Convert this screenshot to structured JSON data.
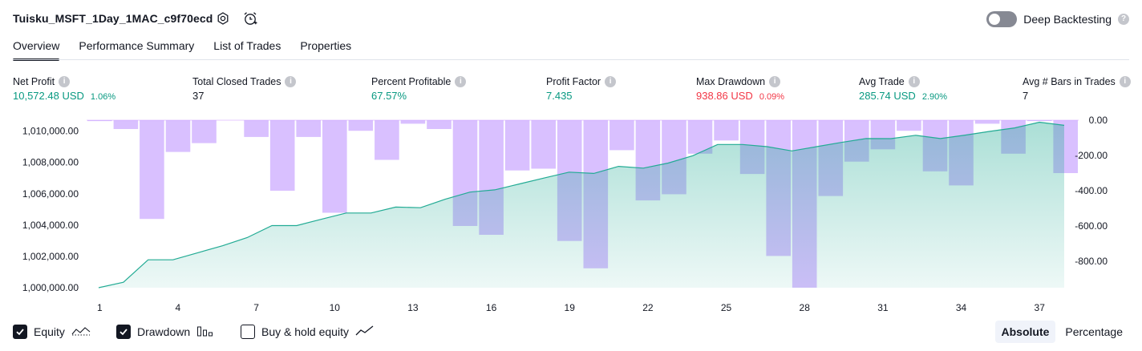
{
  "header": {
    "strategy_title": "Tuisku_MSFT_1Day_1MAC_c9f70ecd",
    "settings_icon": "gear-icon",
    "alert_icon": "alarm-clock-plus-icon",
    "deep_backtesting_label": "Deep Backtesting",
    "deep_backtesting_enabled": false,
    "help_glyph": "?"
  },
  "tabs": [
    {
      "label": "Overview",
      "active": true
    },
    {
      "label": "Performance Summary",
      "active": false
    },
    {
      "label": "List of Trades",
      "active": false
    },
    {
      "label": "Properties",
      "active": false
    }
  ],
  "metrics": [
    {
      "label": "Net Profit",
      "value": "10,572.48 USD",
      "pct": "1.06%",
      "color": "#089981"
    },
    {
      "label": "Total Closed Trades",
      "value": "37",
      "pct": "",
      "color": "#131722"
    },
    {
      "label": "Percent Profitable",
      "value": "67.57%",
      "pct": "",
      "color": "#089981"
    },
    {
      "label": "Profit Factor",
      "value": "7.435",
      "pct": "",
      "color": "#089981"
    },
    {
      "label": "Max Drawdown",
      "value": "938.86 USD",
      "pct": "0.09%",
      "color": "#f23645"
    },
    {
      "label": "Avg Trade",
      "value": "285.74 USD",
      "pct": "2.90%",
      "color": "#089981"
    },
    {
      "label": "Avg # Bars in Trades",
      "value": "7",
      "pct": "",
      "color": "#131722"
    }
  ],
  "chart_data": {
    "type": "area",
    "x_ticks": [
      "1",
      "4",
      "7",
      "10",
      "13",
      "16",
      "19",
      "22",
      "25",
      "28",
      "31",
      "34",
      "37"
    ],
    "left_axis_ticks": [
      "1,010,000.00",
      "1,008,000.00",
      "1,006,000.00",
      "1,004,000.00",
      "1,002,000.00",
      "1,000,000.00"
    ],
    "right_axis_ticks": [
      "0.00",
      "-200.00",
      "-400.00",
      "-600.00",
      "-800.00"
    ],
    "ylim_left": [
      1000000,
      1010700
    ],
    "ylim_right": [
      -950,
      0
    ],
    "series": [
      {
        "name": "Equity",
        "color": "#22ab94",
        "values": [
          1000000,
          1000350,
          1001780,
          1001780,
          1002230,
          1002680,
          1003200,
          1003970,
          1003970,
          1004370,
          1004770,
          1004770,
          1005150,
          1005110,
          1005650,
          1006110,
          1006250,
          1006630,
          1007010,
          1007380,
          1007300,
          1007750,
          1007640,
          1007960,
          1008430,
          1009150,
          1009150,
          1009010,
          1008740,
          1009010,
          1009280,
          1009530,
          1009520,
          1009740,
          1009530,
          1009750,
          1009990,
          1010210,
          1010570,
          1010370
        ]
      },
      {
        "name": "Drawdown",
        "color": "#c199ff",
        "values": [
          -5,
          -50,
          -560,
          -180,
          -130,
          0,
          -95,
          -400,
          -95,
          -525,
          -60,
          -225,
          -20,
          -50,
          -600,
          -650,
          -285,
          -275,
          -685,
          -840,
          -170,
          -455,
          -420,
          -190,
          -115,
          -305,
          -770,
          -950,
          -430,
          -235,
          -165,
          -60,
          -290,
          -370,
          -20,
          -190,
          -5,
          -300
        ]
      }
    ]
  },
  "footer": {
    "checkboxes": [
      {
        "label": "Equity",
        "checked": true,
        "icon": "equity-line-icon"
      },
      {
        "label": "Drawdown",
        "checked": true,
        "icon": "drawdown-bars-icon"
      },
      {
        "label": "Buy & hold equity",
        "checked": false,
        "icon": "buy-hold-line-icon"
      }
    ],
    "mode_buttons": [
      {
        "label": "Absolute",
        "active": true
      },
      {
        "label": "Percentage",
        "active": false
      }
    ]
  }
}
